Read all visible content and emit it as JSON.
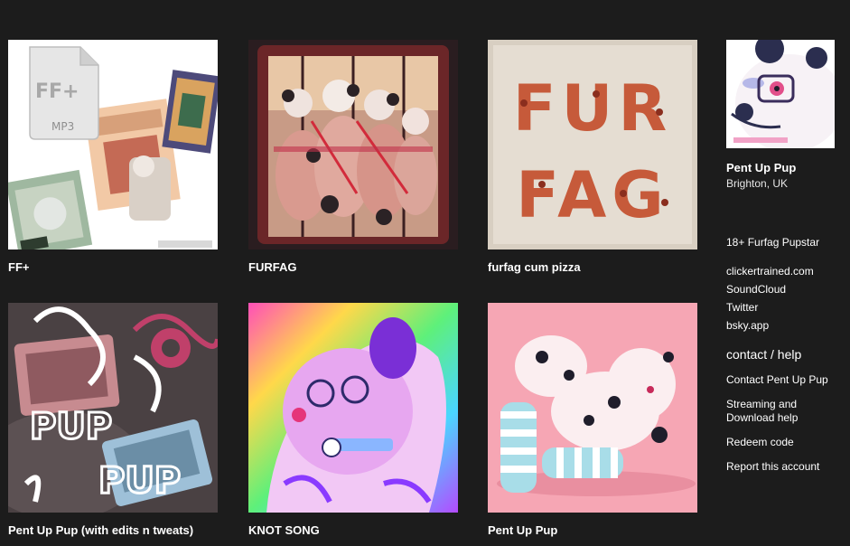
{
  "albums": [
    {
      "title": "FF+",
      "file_icon_label": "FF+",
      "file_icon_ext": "MP3"
    },
    {
      "title": "FURFAG"
    },
    {
      "title": "furfag cum pizza",
      "cover_text": [
        "FUR",
        "FAG"
      ]
    },
    {
      "title": "Pent Up Pup (with edits n tweats)",
      "cover_text": [
        "PUP",
        "PUP"
      ]
    },
    {
      "title": "KNOT SONG"
    },
    {
      "title": "Pent Up Pup"
    }
  ],
  "artist": {
    "name": "Pent Up Pup",
    "location": "Brighton, UK",
    "bio": "18+ Furfag Pupstar",
    "links": [
      "clickertrained.com",
      "SoundCloud",
      "Twitter",
      "bsky.app"
    ]
  },
  "contact": {
    "heading": "contact / help",
    "links": [
      "Contact Pent Up Pup",
      "Streaming and Download help",
      "Redeem code",
      "Report this account"
    ]
  },
  "colors": {
    "background": "#1c1c1c",
    "text": "#ffffff"
  }
}
